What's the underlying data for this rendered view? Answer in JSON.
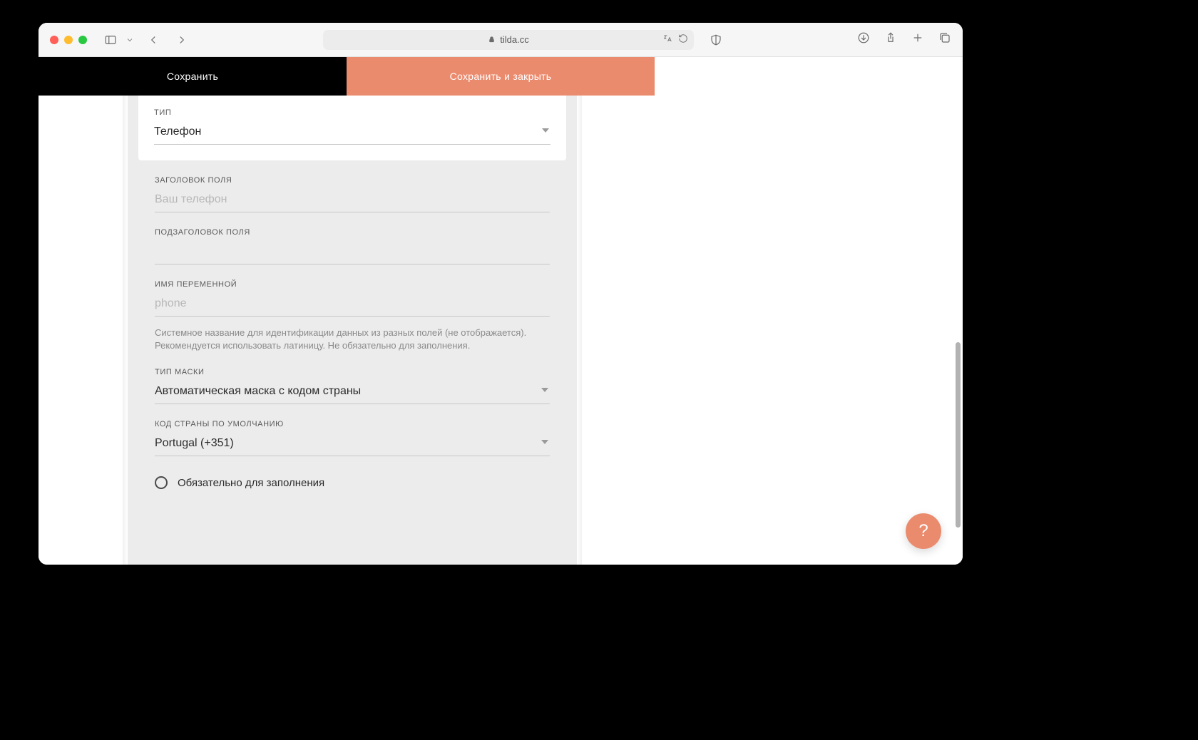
{
  "browser": {
    "url_host": "tilda.cc"
  },
  "action_bar": {
    "save": "Сохранить",
    "save_close": "Сохранить и закрыть"
  },
  "form": {
    "type": {
      "label": "ТИП",
      "value": "Телефон"
    },
    "field_title": {
      "label": "ЗАГОЛОВОК ПОЛЯ",
      "placeholder": "Ваш телефон",
      "value": ""
    },
    "field_subtitle": {
      "label": "ПОДЗАГОЛОВОК ПОЛЯ",
      "value": ""
    },
    "var_name": {
      "label": "ИМЯ ПЕРЕМЕННОЙ",
      "placeholder": "phone",
      "value": "",
      "help": "Системное название для идентификации данных из разных полей (не отображается). Рекомендуется использовать латиницу. Не обязательно для заполнения."
    },
    "mask_type": {
      "label": "ТИП МАСКИ",
      "value": "Автоматическая маска с кодом страны"
    },
    "default_country": {
      "label": "КОД СТРАНЫ ПО УМОЛЧАНИЮ",
      "value": "Portugal (+351)"
    },
    "required": {
      "label": "Обязательно для заполнения",
      "checked": false
    }
  },
  "help_fab": "?"
}
